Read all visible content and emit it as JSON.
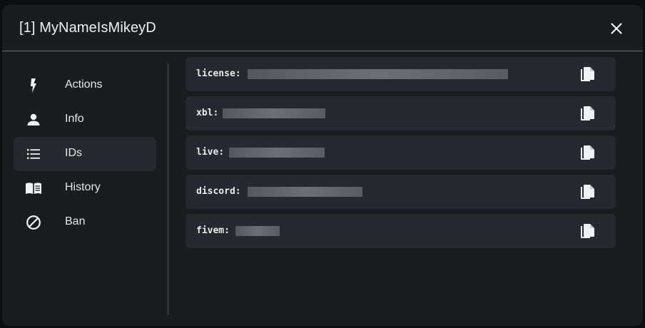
{
  "header": {
    "title": "[1] MyNameIsMikeyD"
  },
  "sidebar": {
    "items": [
      {
        "label": "Actions",
        "icon": "lightning-icon",
        "active": false
      },
      {
        "label": "Info",
        "icon": "person-icon",
        "active": false
      },
      {
        "label": "IDs",
        "icon": "list-icon",
        "active": true
      },
      {
        "label": "History",
        "icon": "book-icon",
        "active": false
      },
      {
        "label": "Ban",
        "icon": "ban-icon",
        "active": false
      }
    ]
  },
  "ids": {
    "rows": [
      {
        "key": "license:",
        "value_redacted": true,
        "copy_icon": "copy-icon"
      },
      {
        "key": "xbl:",
        "value_redacted": true,
        "copy_icon": "copy-icon"
      },
      {
        "key": "live:",
        "value_redacted": true,
        "copy_icon": "copy-icon"
      },
      {
        "key": "discord:",
        "value_redacted": true,
        "copy_icon": "copy-icon"
      },
      {
        "key": "fivem:",
        "value_redacted": true,
        "copy_icon": "copy-icon"
      }
    ]
  },
  "colors": {
    "background": "#0d0e10",
    "panel": "#1a1c1f",
    "row": "#26292d",
    "text": "#e9eaec",
    "redaction": "#5e6165"
  }
}
